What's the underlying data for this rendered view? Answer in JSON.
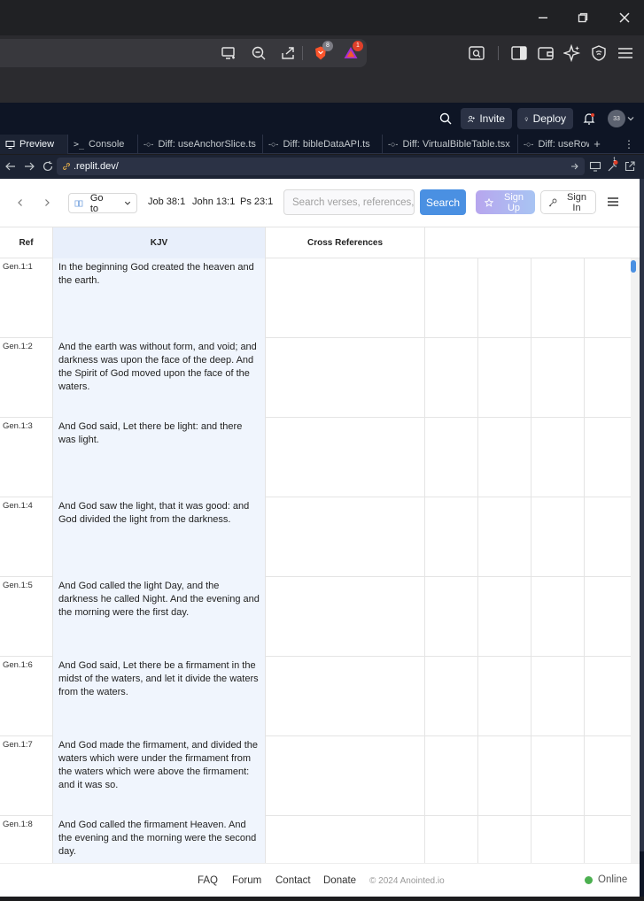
{
  "replit": {
    "invite_label": "Invite",
    "deploy_label": "Deploy",
    "avatar_text": "33",
    "tabs": [
      {
        "label": "Preview"
      },
      {
        "label": "Console"
      },
      {
        "label": "Diff: useAnchorSlice.ts"
      },
      {
        "label": "Diff: bibleDataAPI.ts"
      },
      {
        "label": "Diff: VirtualBibleTable.tsx"
      },
      {
        "label": "Diff: useRow"
      }
    ],
    "url": ".replit.dev/"
  },
  "browser": {
    "brave_badge": "8",
    "alert_badge": "1",
    "tools_badge": "1"
  },
  "app": {
    "goto_label": "Go to",
    "quick_links": [
      "Job 38:1",
      "John 13:1",
      "Ps 23:1"
    ],
    "search_placeholder": "Search verses, references, or...",
    "search_label": "Search",
    "signup_label": "Sign Up",
    "signin_label": "Sign In",
    "columns": [
      "Ref",
      "KJV",
      "Cross References"
    ],
    "verses": [
      {
        "ref": "Gen.1:1",
        "text": "In the beginning God created the heaven and the earth."
      },
      {
        "ref": "Gen.1:2",
        "text": "And the earth was without form, and void; and darkness was upon the face of the deep. And the Spirit of God moved upon the face of the waters."
      },
      {
        "ref": "Gen.1:3",
        "text": "And God said, Let there be light: and there was light."
      },
      {
        "ref": "Gen.1:4",
        "text": "And God saw the light, that it was good: and God divided the light from the darkness."
      },
      {
        "ref": "Gen.1:5",
        "text": "And God called the light Day, and the darkness he called Night. And the evening and the morning were the first day."
      },
      {
        "ref": "Gen.1:6",
        "text": "And God said, Let there be a firmament in the midst of the waters, and let it divide the waters from the waters."
      },
      {
        "ref": "Gen.1:7",
        "text": "And God made the firmament, and divided the waters which were under the firmament from the waters which were above the firmament: and it was so."
      },
      {
        "ref": "Gen.1:8",
        "text": "And God called the firmament Heaven. And the evening and the morning were the second day."
      }
    ],
    "footer": {
      "links": [
        "FAQ",
        "Forum",
        "Contact",
        "Donate"
      ],
      "copyright": "© 2024 Anointed.io",
      "status": "Online"
    }
  },
  "colors": {
    "accent": "#4a90e2",
    "kjv_column": "#f0f5fd",
    "online": "#4cb050"
  }
}
